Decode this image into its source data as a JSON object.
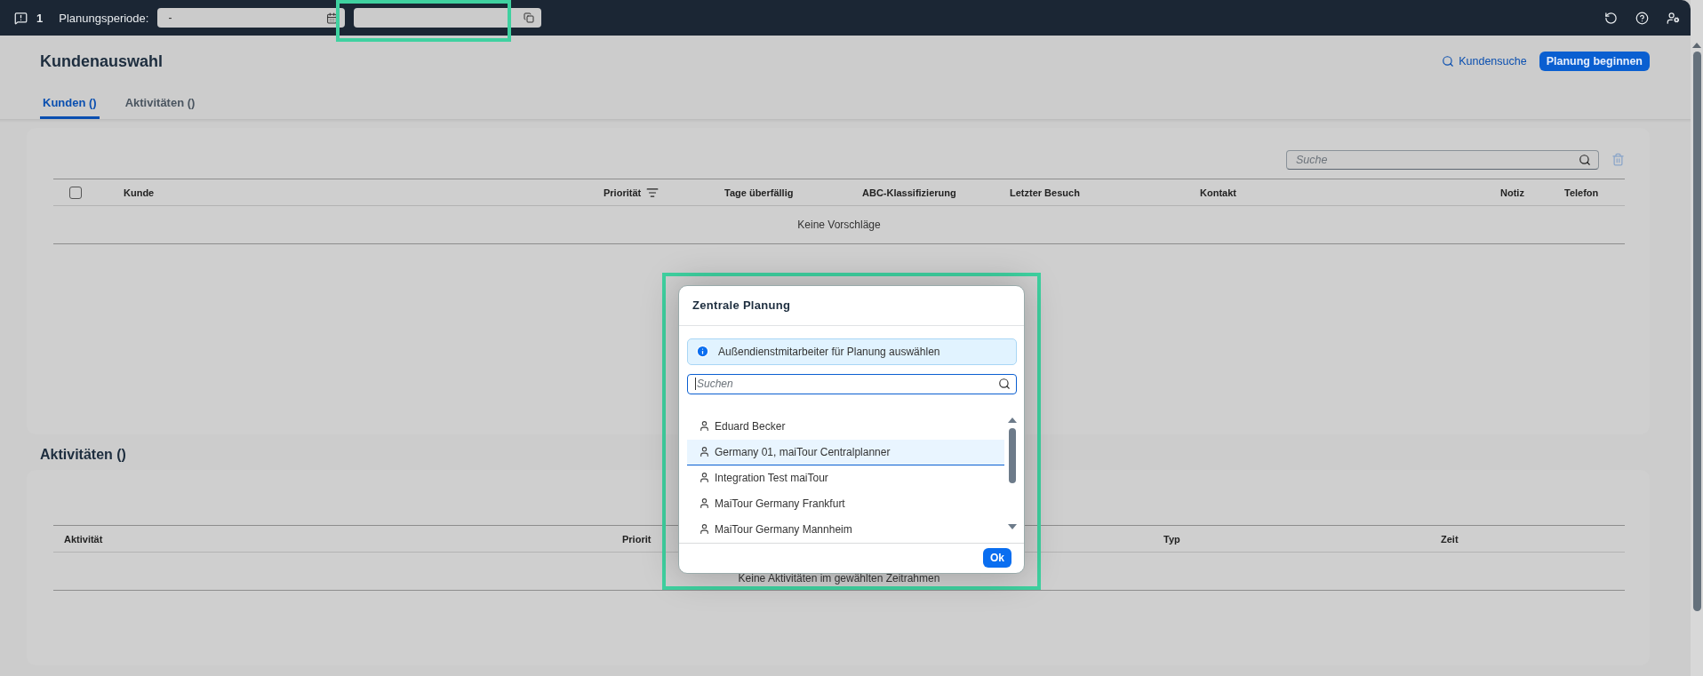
{
  "toolbar": {
    "message_count": "1",
    "period_label": "Planungsperiode:",
    "period_value": "-"
  },
  "page": {
    "title": "Kundenauswahl",
    "actions": [
      {
        "label": "Kundensuche",
        "kind": "link"
      },
      {
        "label": "Planung beginnen",
        "kind": "primary"
      }
    ]
  },
  "tabs": [
    {
      "label": "Kunden ()",
      "selected": true
    },
    {
      "label": "Aktivitäten ()",
      "selected": false
    }
  ],
  "customers": {
    "search": {
      "placeholder": "Suche"
    },
    "select_all": {
      "checked": false
    },
    "columns": [
      "Kunde",
      "Priorität",
      "Tage überfällig",
      "ABC-Klassifizierung",
      "Letzter Besuch",
      "Kontakt",
      "Notiz",
      "Telefon"
    ],
    "empty_text": "Keine Vorschläge"
  },
  "activities": {
    "title": "Aktivitäten ()",
    "columns": [
      "Aktivität",
      "Priorit",
      "Typ",
      "Zeit"
    ],
    "empty_text": "Keine Aktivitäten im gewählten Zeitrahmen"
  },
  "dialog": {
    "title": "Zentrale Planung",
    "info": "Außendienstmitarbeiter für Planung auswählen",
    "search": {
      "placeholder": "Suchen"
    },
    "items": [
      {
        "name": "Eduard Becker",
        "selected": false
      },
      {
        "name": "Germany 01, maiTour Centralplanner",
        "selected": true
      },
      {
        "name": "Integration Test maiTour",
        "selected": false
      },
      {
        "name": "MaiTour Germany Frankfurt",
        "selected": false
      },
      {
        "name": "MaiTour Germany Mannheim",
        "selected": false
      }
    ],
    "ok": "Ok"
  }
}
